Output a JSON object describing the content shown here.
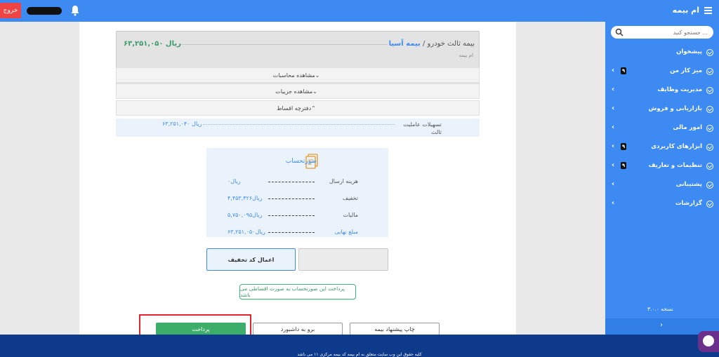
{
  "header": {
    "exit_label": "خروج",
    "app_title": "ام بیمه"
  },
  "policy_card": {
    "title": "بیمه ثالث خودرو",
    "separator": "/",
    "insurer": "بیمه آسیا",
    "subtitle": "ام بیمه",
    "price": "۶۳,۲۵۱,۰۵۰ ریال"
  },
  "accordions": {
    "calculations": "مشاهده محاسبات",
    "details": "مشاهده جزییات",
    "installments": "دفترچه اقساط"
  },
  "facility": {
    "label": "تسهیلات عاملیت ثالث",
    "value": "۶۳,۲۵۱,۰۴۰ ریال"
  },
  "invoice": {
    "title": "صورتحساب",
    "rows": [
      {
        "label": "هزینه ارسال",
        "value": "۰ریال"
      },
      {
        "label": "تخفیف",
        "value": "۴,۴۵۳,۴۲۶ریال"
      },
      {
        "label": "مالیات",
        "value": "۵,۷۵۰,۰۹۵ریال"
      },
      {
        "label": "مبلغ نهایی",
        "value": "۶۳,۲۵۱,۰۵۰ریال"
      }
    ]
  },
  "discount": {
    "apply_label": "اعمال کد تخفیف"
  },
  "notice": "پرداخت این صورتحساب به صورت اقساطی می باشد",
  "actions": {
    "pay": "پرداخت",
    "dashboard": "برو به داشبورد",
    "print": "چاپ پیشنهاد بیمه"
  },
  "footer": "کلیه حقوق این وب سایت متعلق به ام بیمه کد بیمه مرکزی ۱۱ می باشد",
  "sidebar": {
    "search_placeholder": "جستجو کنید ...",
    "items": [
      {
        "label": "پیشخوان"
      },
      {
        "label": "میز کار من",
        "badge": "۹"
      },
      {
        "label": "مدیریت وظایف"
      },
      {
        "label": "بازاریابی و فروش"
      },
      {
        "label": "امور مالی"
      },
      {
        "label": "ابزارهای کاربردی",
        "badge": "۹"
      },
      {
        "label": "تنظیمات و تعاریف",
        "badge": "۹"
      },
      {
        "label": "پشتیبانی"
      },
      {
        "label": "گزارشات"
      }
    ],
    "version": "نسخه ۳.۰.۰"
  },
  "colors": {
    "primary": "#3d8bf2",
    "success": "#3dad6a",
    "danger": "#ef4444",
    "footer": "#0e3a8c"
  }
}
